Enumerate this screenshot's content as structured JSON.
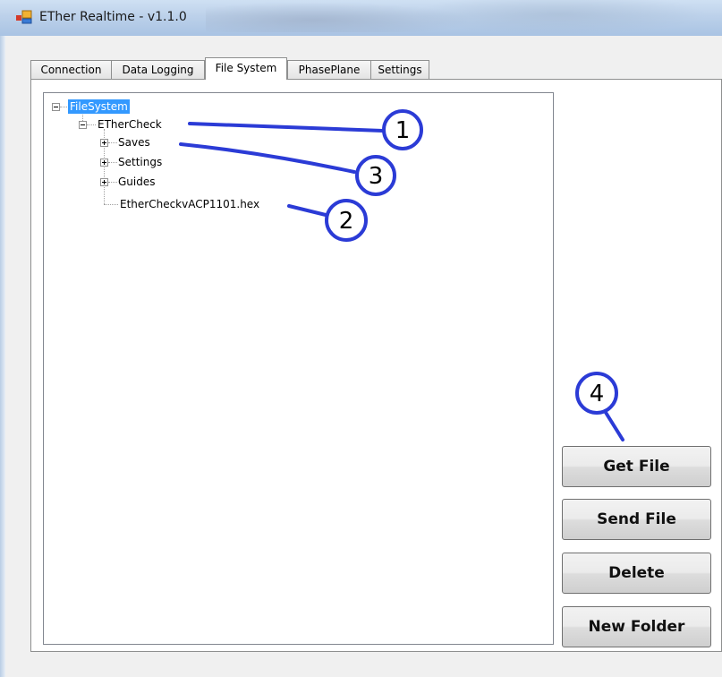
{
  "window": {
    "title": "ETher Realtime - v1.1.0"
  },
  "tabs": [
    {
      "label": "Connection"
    },
    {
      "label": "Data Logging"
    },
    {
      "label": "File System",
      "active": true
    },
    {
      "label": "PhasePlane"
    },
    {
      "label": "Settings"
    }
  ],
  "tree": {
    "root": "FileSystem",
    "device": "ETherCheck",
    "folders": [
      "Saves",
      "Settings",
      "Guides"
    ],
    "file": "EtherCheckvACP1101.hex"
  },
  "buttons": {
    "get_file": "Get File",
    "send_file": "Send File",
    "delete": "Delete",
    "new_folder": "New Folder"
  },
  "callouts": [
    "1",
    "2",
    "3",
    "4"
  ],
  "colors": {
    "callout": "#2b3bd6",
    "selection": "#3399ff"
  }
}
